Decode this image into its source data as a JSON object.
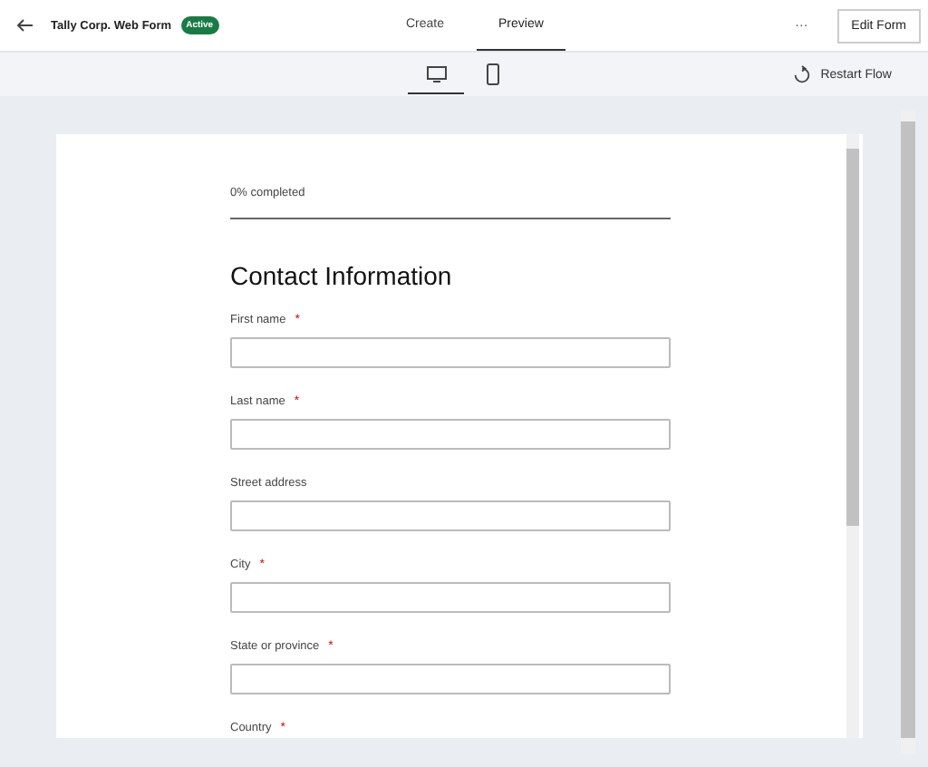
{
  "header": {
    "title": "Tally Corp. Web Form",
    "status": "Active",
    "tabs": [
      {
        "label": "Create",
        "selected": false
      },
      {
        "label": "Preview",
        "selected": true
      }
    ],
    "more": "···",
    "edit_button": "Edit Form"
  },
  "toolbar": {
    "devices": [
      {
        "kind": "desktop",
        "selected": true
      },
      {
        "kind": "mobile",
        "selected": false
      }
    ],
    "restart": "Restart Flow"
  },
  "form": {
    "progress": {
      "label": "0% completed",
      "level": 0
    },
    "heading": "Contact Information",
    "fields": [
      {
        "label": "First name",
        "required": true
      },
      {
        "label": "Last name",
        "required": true
      },
      {
        "label": "Street address",
        "required": false
      },
      {
        "label": "City",
        "required": true
      },
      {
        "label": "State or province",
        "required": true
      },
      {
        "label": "Country",
        "required": true
      }
    ],
    "required_mark": "*"
  }
}
